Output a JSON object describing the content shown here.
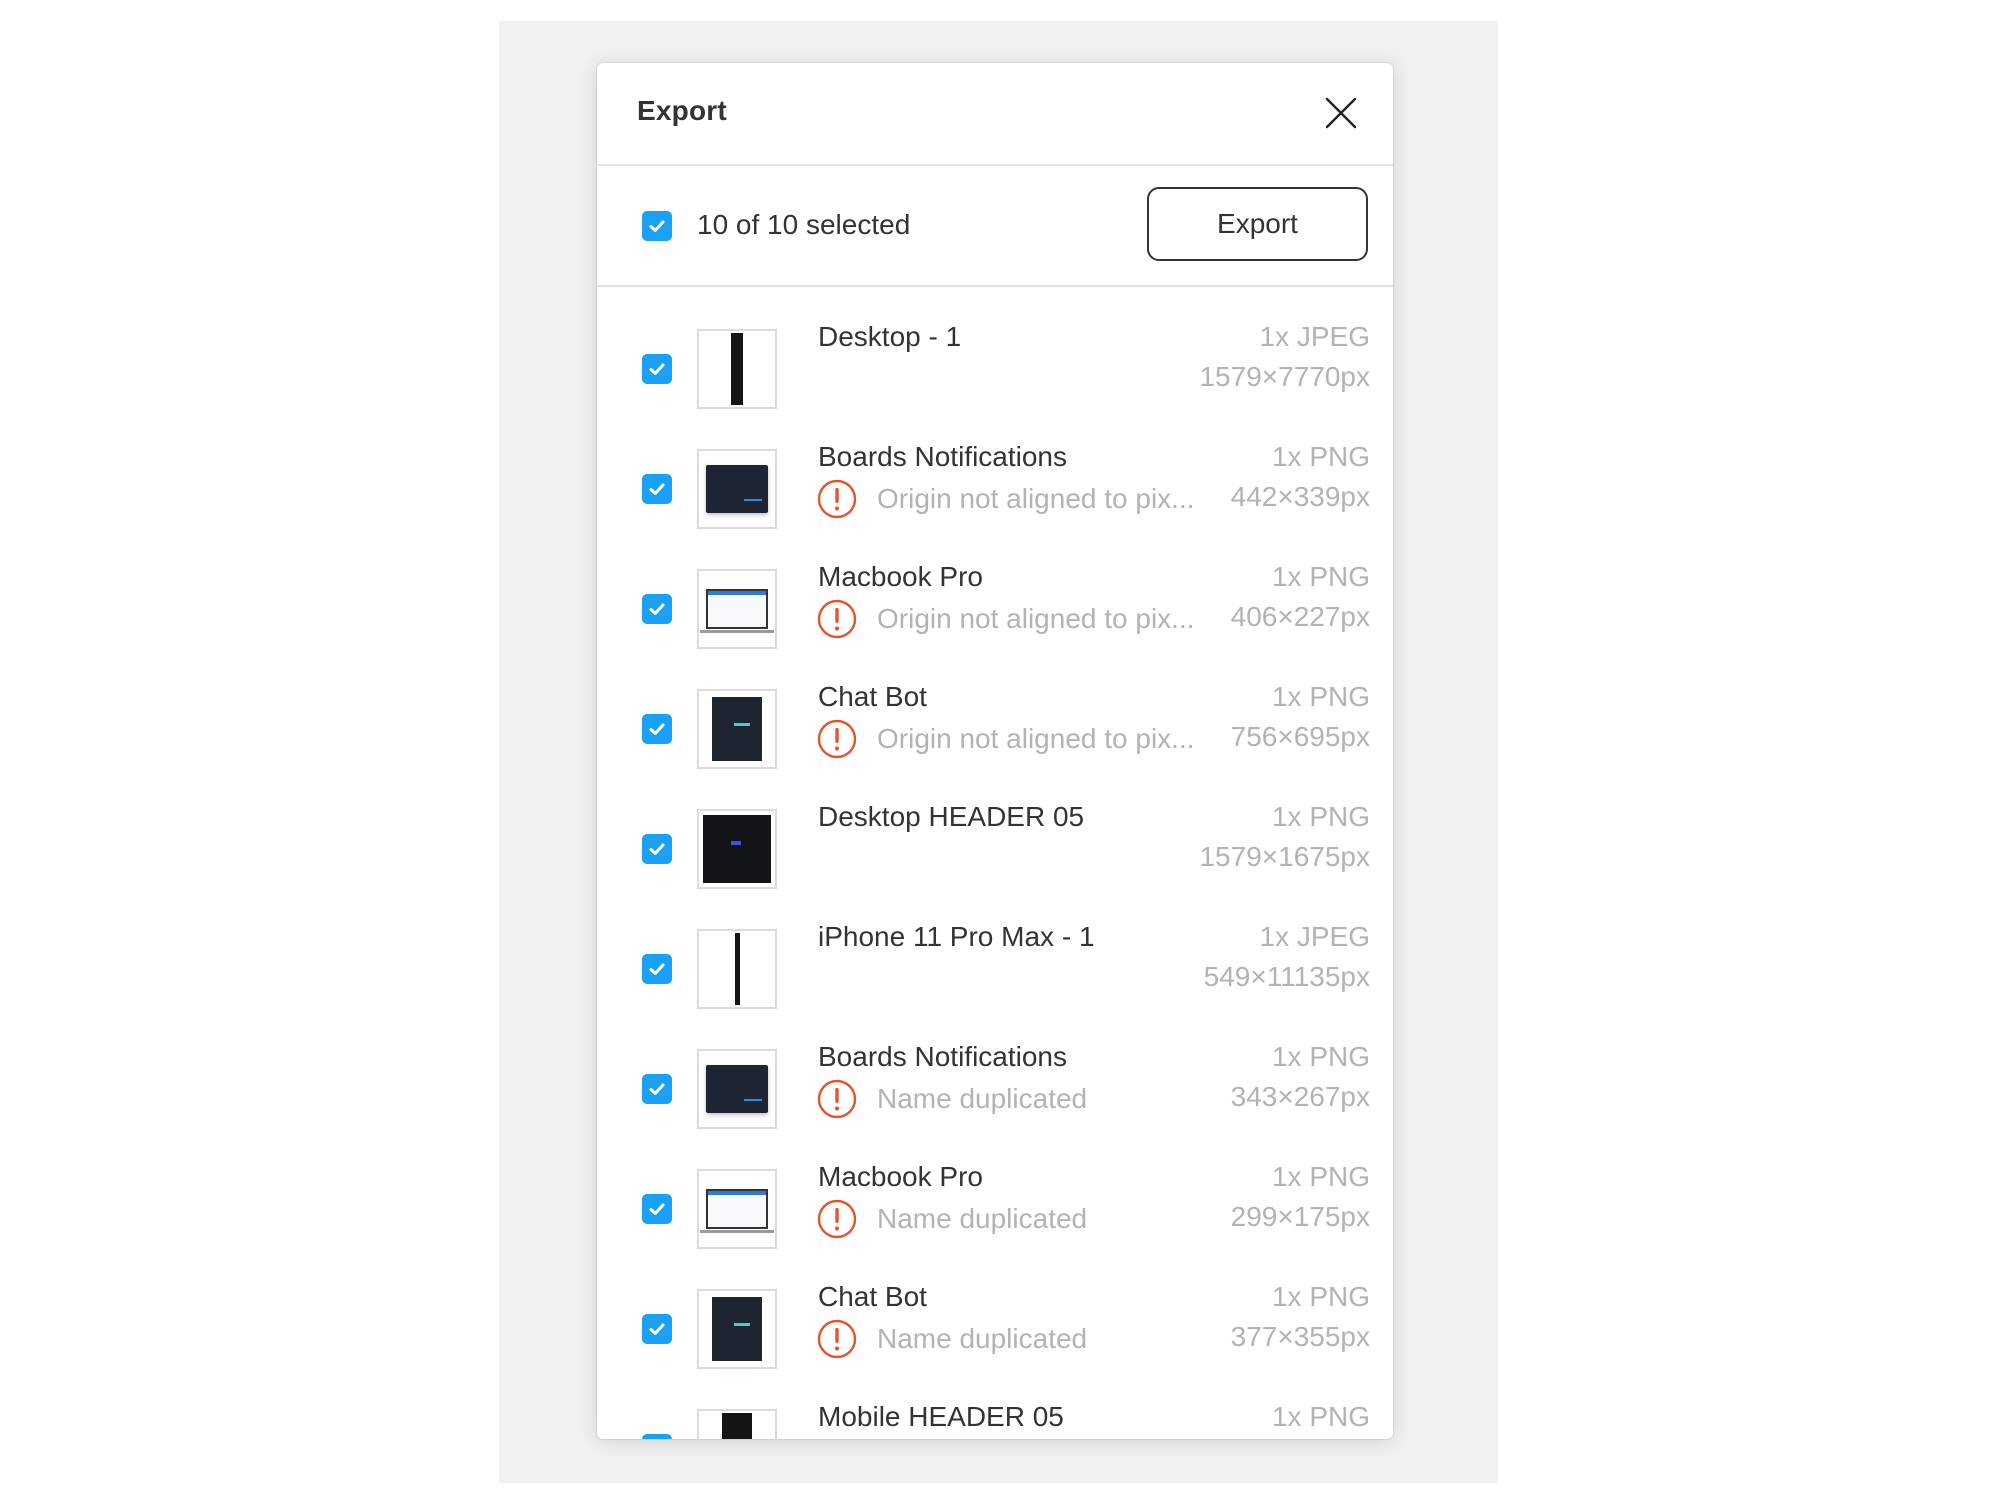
{
  "dialog": {
    "title": "Export",
    "close_icon": "close-icon"
  },
  "toolbar": {
    "select_all_checked": true,
    "selected_count": 10,
    "total_count": 10,
    "selection_text": "10 of 10 selected",
    "export_label": "Export"
  },
  "colors": {
    "checkbox_accent": "#1aa0f5",
    "warning": "#e0572f",
    "muted_text": "#b3b3b3",
    "primary_text": "#333333",
    "backdrop": "#f0f0f0"
  },
  "items": [
    {
      "name": "Desktop - 1",
      "format": "1x JPEG",
      "dims": "1579×7770px",
      "warning": "",
      "checked": true,
      "thumb": "tall-page"
    },
    {
      "name": "Boards Notifications",
      "format": "1x PNG",
      "dims": "442×339px",
      "warning": "Origin not aligned to pix...",
      "checked": true,
      "thumb": "dark-dashboard"
    },
    {
      "name": "Macbook Pro",
      "format": "1x PNG",
      "dims": "406×227px",
      "warning": "Origin not aligned to pix...",
      "checked": true,
      "thumb": "laptop"
    },
    {
      "name": "Chat Bot",
      "format": "1x PNG",
      "dims": "756×695px",
      "warning": "Origin not aligned to pix...",
      "checked": true,
      "thumb": "dark-chat"
    },
    {
      "name": "Desktop HEADER 05",
      "format": "1x PNG",
      "dims": "1579×1675px",
      "warning": "",
      "checked": true,
      "thumb": "dark-header"
    },
    {
      "name": "iPhone 11 Pro Max - 1",
      "format": "1x JPEG",
      "dims": "549×11135px",
      "warning": "",
      "checked": true,
      "thumb": "phone-strip"
    },
    {
      "name": "Boards Notifications",
      "format": "1x PNG",
      "dims": "343×267px",
      "warning": "Name duplicated",
      "checked": true,
      "thumb": "dark-dashboard"
    },
    {
      "name": "Macbook Pro",
      "format": "1x PNG",
      "dims": "299×175px",
      "warning": "Name duplicated",
      "checked": true,
      "thumb": "laptop"
    },
    {
      "name": "Chat Bot",
      "format": "1x PNG",
      "dims": "377×355px",
      "warning": "Name duplicated",
      "checked": true,
      "thumb": "dark-chat"
    },
    {
      "name": "Mobile HEADER 05",
      "format": "1x PNG",
      "dims": "",
      "warning": "",
      "checked": true,
      "thumb": "mobile-header"
    }
  ]
}
